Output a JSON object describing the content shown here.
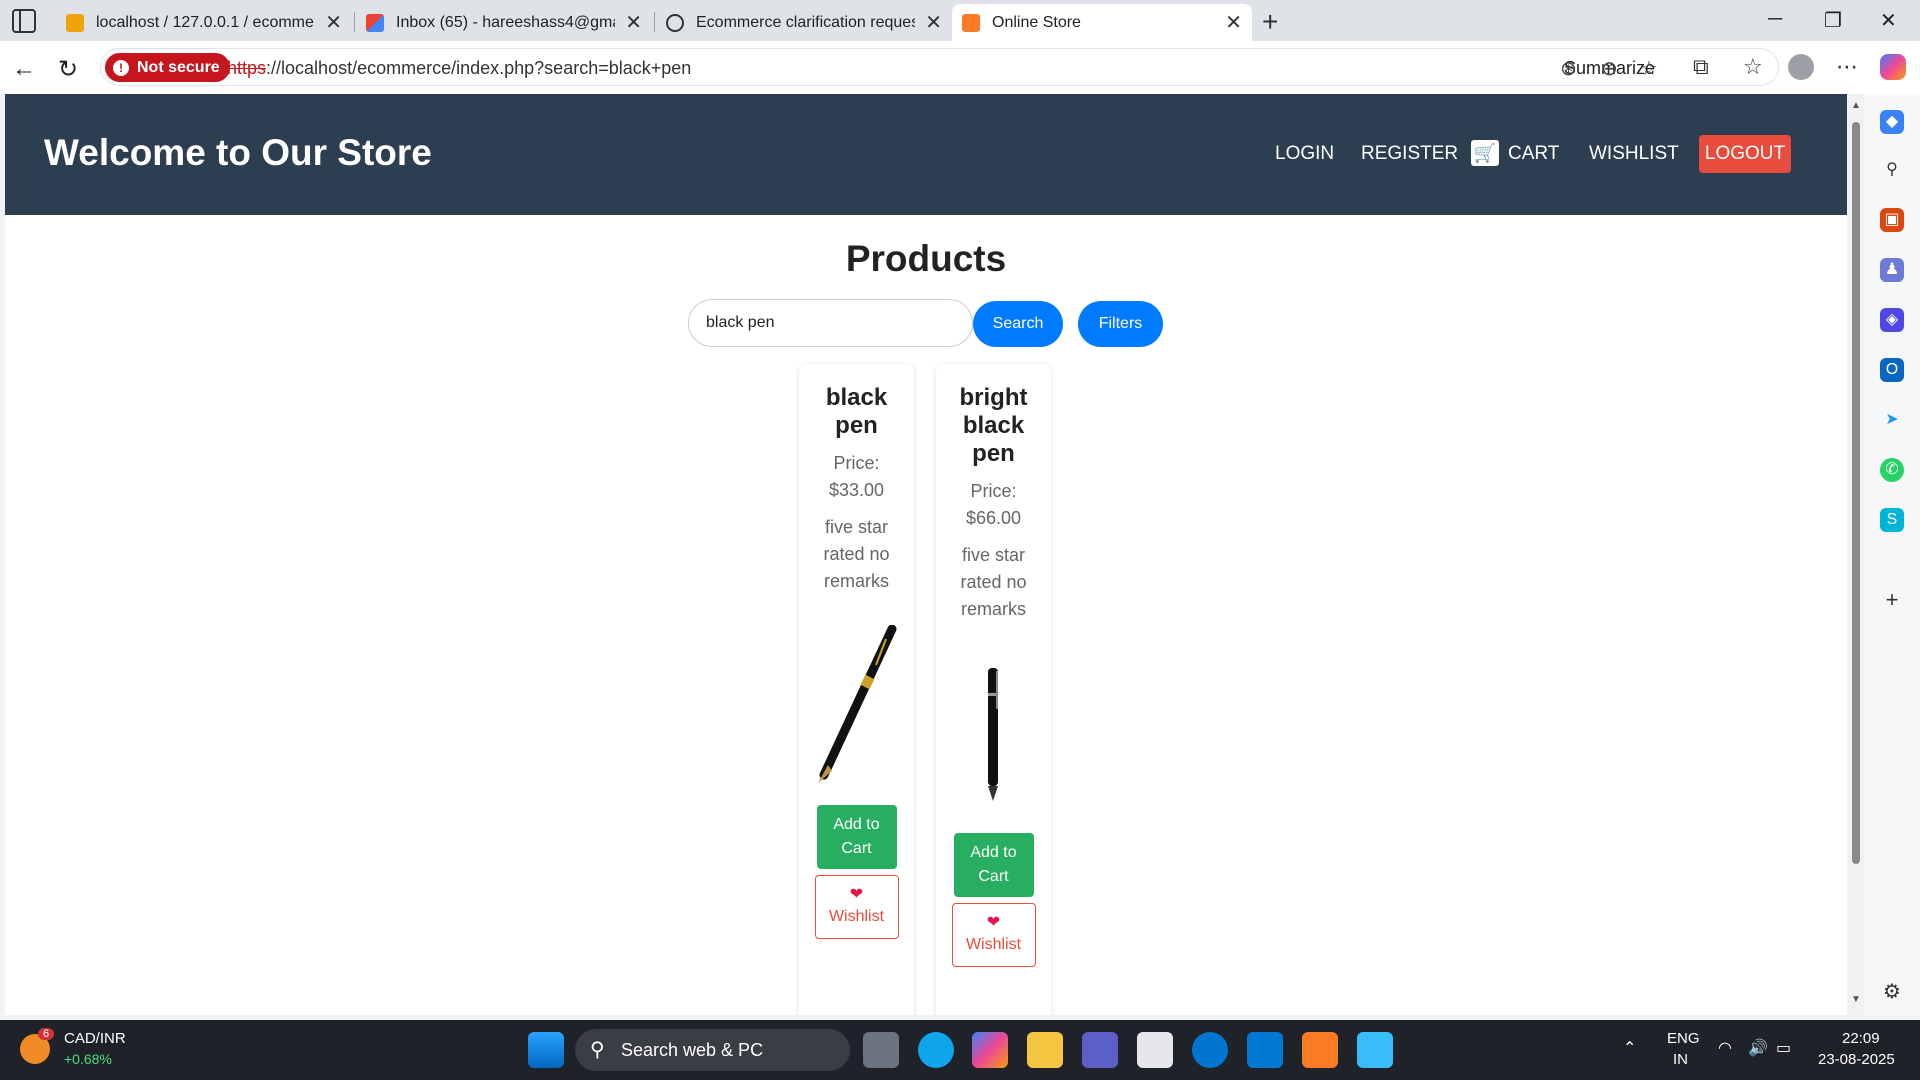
{
  "browser": {
    "tabs": [
      {
        "title": "localhost / 127.0.0.1 / ecommerce",
        "favicon": "phpmyadmin-icon",
        "active": false
      },
      {
        "title": "Inbox (65) - hareeshass4@gmail.com",
        "favicon": "gmail-icon",
        "active": false
      },
      {
        "title": "Ecommerce clarification request",
        "favicon": "chatgpt-icon",
        "active": false
      },
      {
        "title": "Online Store",
        "favicon": "xampp-icon",
        "active": true
      }
    ],
    "security_label": "Not secure",
    "url_scheme": "https",
    "url_rest": "://localhost/ecommerce/index.php?search=black+pen",
    "summarize_label": "Summarize"
  },
  "site": {
    "title": "Welcome to Our Store",
    "nav": {
      "login": "LOGIN",
      "register": "REGISTER",
      "cart": "CART",
      "wishlist": "WISHLIST",
      "logout": "LOGOUT"
    },
    "products_heading": "Products",
    "search": {
      "value": "black pen",
      "button": "Search"
    },
    "filters_button": "Filters",
    "products": [
      {
        "name": "black pen",
        "price_label": "Price:",
        "price": "$33.00",
        "description": "five star rated no remarks",
        "add_to_cart": "Add to Cart",
        "wishlist": "Wishlist"
      },
      {
        "name": "bright black pen",
        "price_label": "Price:",
        "price": "$66.00",
        "description": "five star rated no remarks",
        "add_to_cart": "Add to Cart",
        "wishlist": "Wishlist"
      }
    ]
  },
  "taskbar": {
    "widget_badge": "6",
    "widget_title": "CAD/INR",
    "widget_change": "+0.68%",
    "search_placeholder": "Search web & PC",
    "lang": "ENG",
    "region": "IN",
    "time": "22:09",
    "date": "23-08-2025"
  },
  "colors": {
    "header_bg": "#2c3e50",
    "logout_bg": "#e74c3c",
    "primary_blue": "#007bff",
    "cart_green": "#27ae60",
    "not_secure_red": "#c4161c"
  }
}
